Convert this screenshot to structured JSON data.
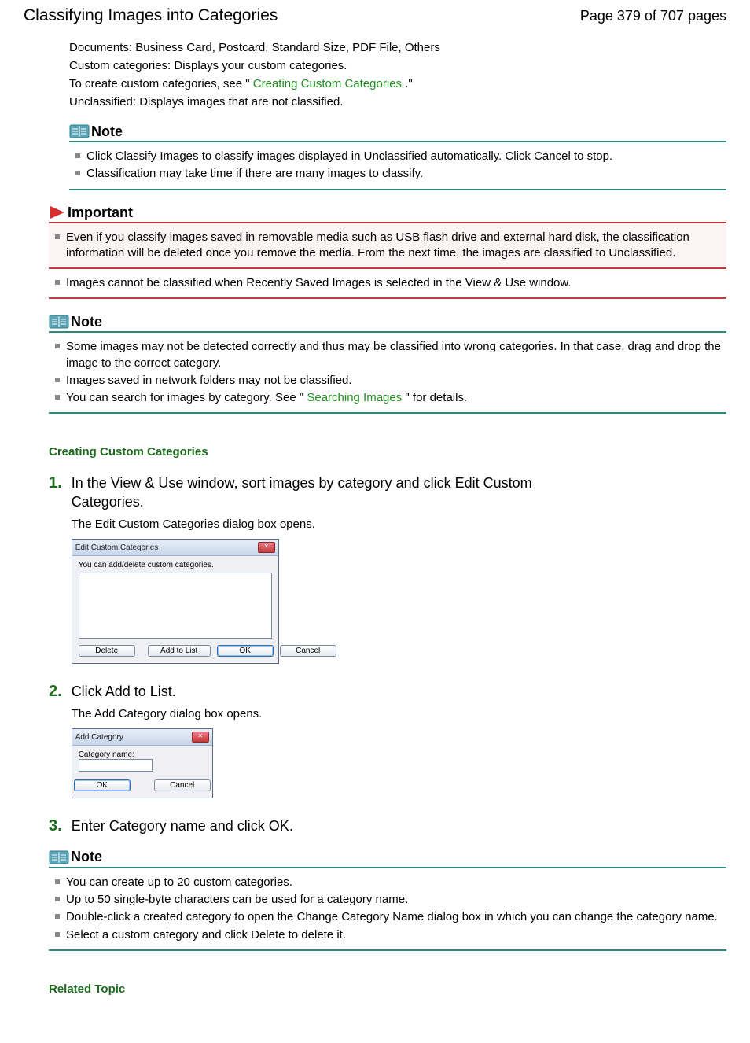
{
  "header": {
    "title": "Classifying Images into Categories",
    "page_label": "Page 379 of 707 pages"
  },
  "intro": {
    "documents": "Documents: Business Card, Postcard, Standard Size, PDF File, Others",
    "custom_cat": "Custom categories: Displays your custom categories.",
    "create_pre": "To create custom categories, see \"",
    "create_link": "Creating Custom Categories",
    "create_post": ".\"",
    "unclassified": "Unclassified: Displays images that are not classified."
  },
  "note1": {
    "title": "Note",
    "items": [
      "Click Classify Images to classify images displayed in Unclassified automatically. Click Cancel to stop.",
      "Classification may take time if there are many images to classify."
    ]
  },
  "important": {
    "title": "Important",
    "items": [
      "Even if you classify images saved in removable media such as USB flash drive and external hard disk, the classification information will be deleted once you remove the media. From the next time, the images are classified to Unclassified.",
      "Images cannot be classified when Recently Saved Images is selected in the View & Use window."
    ]
  },
  "note2": {
    "title": "Note",
    "items_pre": [
      "Some images may not be detected correctly and thus may be classified into wrong categories. In that case, drag and drop the image to the correct category.",
      "Images saved in network folders may not be classified."
    ],
    "search_pre": "You can search for images by category. See \"",
    "search_link": "Searching Images",
    "search_post": "\" for details."
  },
  "section_heading": "Creating Custom Categories",
  "steps": {
    "s1": {
      "num": "1.",
      "title": "In the View & Use window, sort images by category and click Edit Custom Categories.",
      "sub": "The Edit Custom Categories dialog box opens."
    },
    "s2": {
      "num": "2.",
      "title": "Click Add to List.",
      "sub": "The Add Category dialog box opens."
    },
    "s3": {
      "num": "3.",
      "title": "Enter Category name and click OK."
    }
  },
  "dialog1": {
    "title": "Edit Custom Categories",
    "hint": "You can add/delete custom categories.",
    "btn_delete": "Delete",
    "btn_add": "Add to List",
    "btn_ok": "OK",
    "btn_cancel": "Cancel"
  },
  "dialog2": {
    "title": "Add Category",
    "label": "Category name:",
    "btn_ok": "OK",
    "btn_cancel": "Cancel"
  },
  "note3": {
    "title": "Note",
    "items": [
      "You can create up to 20 custom categories.",
      "Up to 50 single-byte characters can be used for a category name.",
      "Double-click a created category to open the Change Category Name dialog box in which you can change the category name.",
      "Select a custom category and click Delete to delete it."
    ]
  },
  "related": "Related Topic"
}
